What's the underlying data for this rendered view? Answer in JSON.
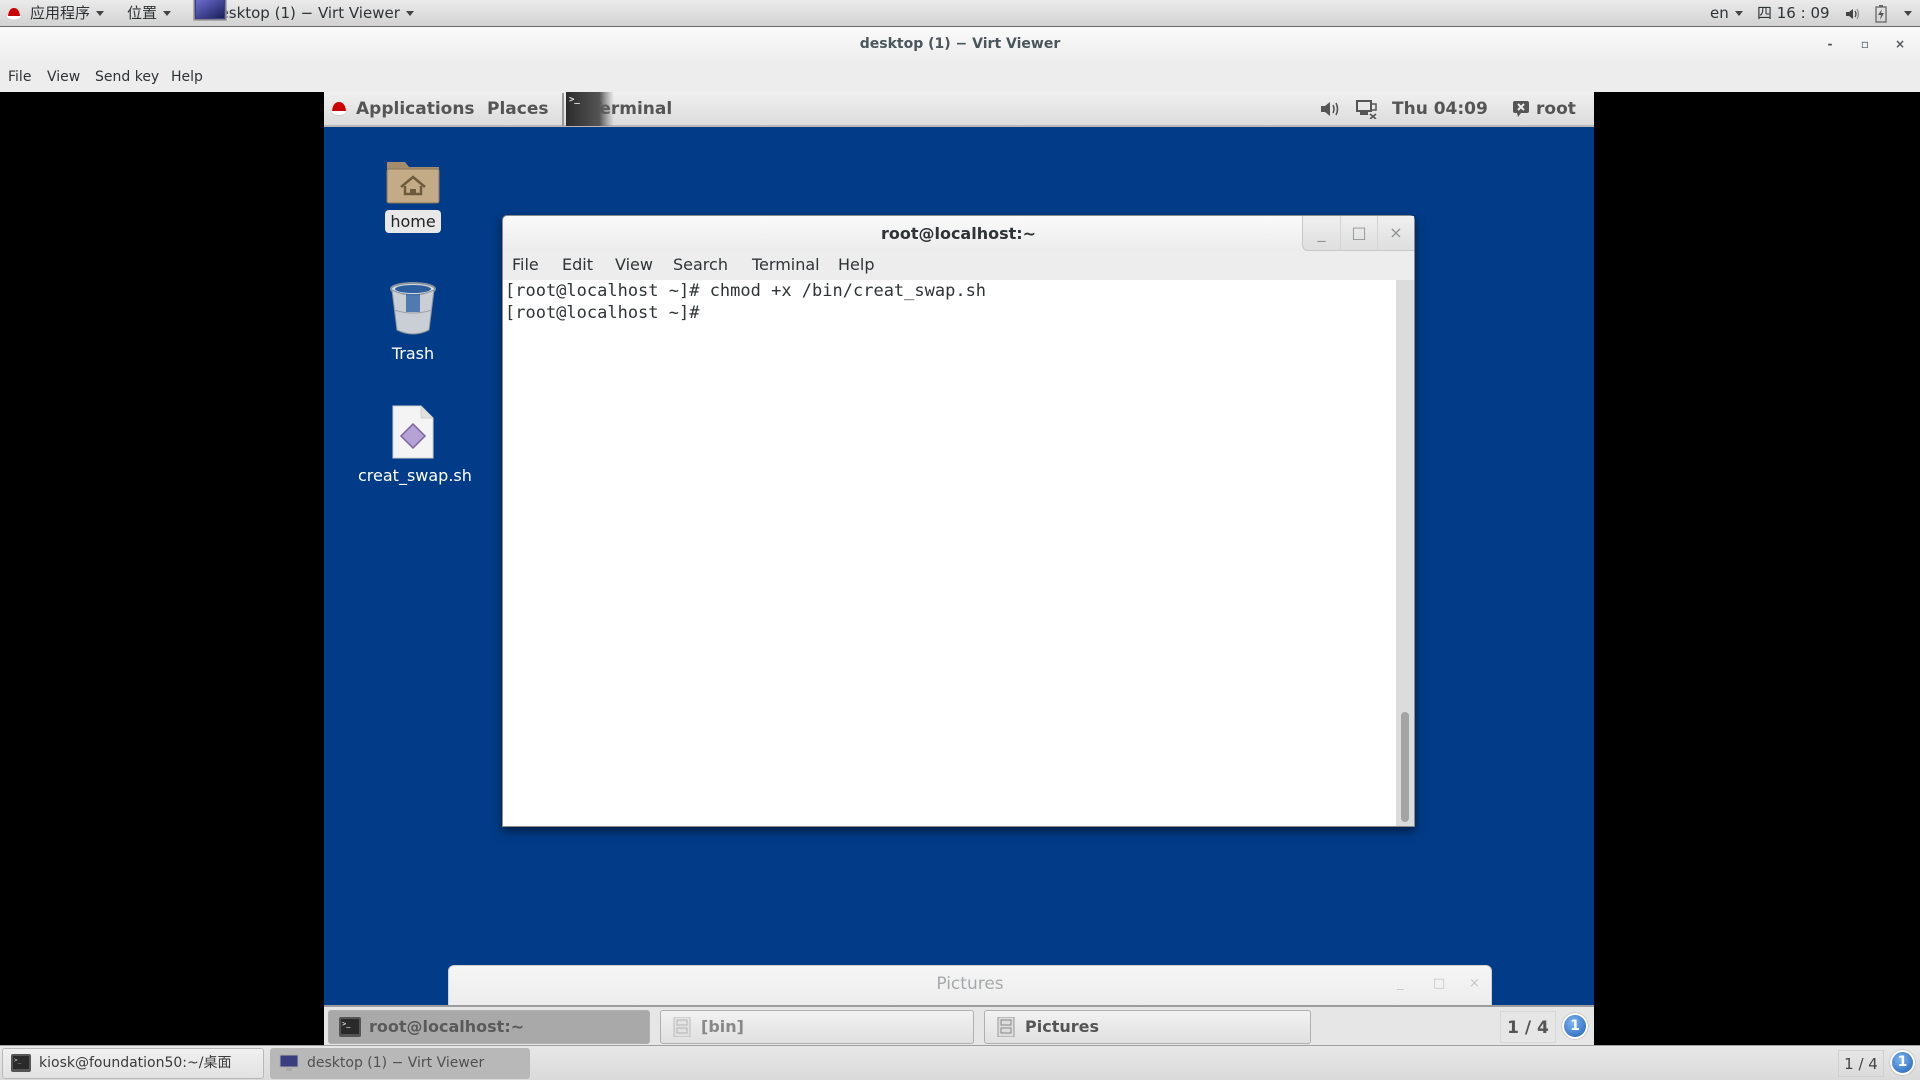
{
  "host_top_panel": {
    "applications_label": "应用程序",
    "places_label": "位置",
    "active_window_label": "desktop (1) − Virt Viewer",
    "input_method": "en",
    "clock": "四 16 : 09",
    "icons": [
      "redhat-logo-icon",
      "virt-viewer-icon",
      "volume-icon",
      "battery-icon",
      "system-menu-icon"
    ]
  },
  "virt_viewer": {
    "title": "desktop (1) − Virt Viewer",
    "controls": {
      "minimize": "-",
      "maximize": "▫",
      "close": "×"
    },
    "menu": [
      "File",
      "View",
      "Send key",
      "Help"
    ]
  },
  "guest_top_panel": {
    "applications_label": "Applications",
    "places_label": "Places",
    "active_window_label": "Terminal",
    "clock": "Thu 04:09",
    "user": "root",
    "icons": [
      "redhat-logo-icon",
      "terminal-icon",
      "volume-icon",
      "network-disconnected-icon",
      "user-icon"
    ]
  },
  "desktop_icons": [
    {
      "label": "home",
      "icon": "home-folder-icon",
      "selected": true
    },
    {
      "label": "Trash",
      "icon": "trash-icon",
      "selected": false
    },
    {
      "label": "creat_swap.sh",
      "icon": "script-file-icon",
      "selected": false
    }
  ],
  "terminal_window": {
    "title": "root@localhost:~",
    "controls": {
      "minimize": "_",
      "maximize": "□",
      "close": "×"
    },
    "menu": [
      "File",
      "Edit",
      "View",
      "Search",
      "Terminal",
      "Help"
    ],
    "lines": [
      "[root@localhost ~]# chmod +x /bin/creat_swap.sh",
      "[root@localhost ~]# "
    ],
    "scroll_position_fraction": 1.0
  },
  "pictures_window": {
    "title": "Pictures",
    "controls": {
      "minimize": "_",
      "maximize": "□",
      "close": "×"
    }
  },
  "guest_taskbar": {
    "buttons": [
      {
        "label": "root@localhost:~",
        "icon": "terminal-icon",
        "active": true
      },
      {
        "label": "[bin]",
        "icon": "file-cabinet-icon",
        "active": false
      },
      {
        "label": "Pictures",
        "icon": "file-cabinet-icon",
        "active": false
      }
    ],
    "workspace": "1 / 4",
    "notification_count": "1"
  },
  "host_taskbar": {
    "buttons": [
      {
        "label": "kiosk@foundation50:~/桌面",
        "icon": "terminal-icon",
        "active": false
      },
      {
        "label": "desktop (1) − Virt Viewer",
        "icon": "virt-viewer-icon",
        "active": true
      }
    ],
    "workspace": "1 / 4",
    "notification_count": "1"
  },
  "colors": {
    "guest_desktop": "#023c88",
    "panel_text": "#2e3436",
    "redhat_red": "#cc0000"
  }
}
